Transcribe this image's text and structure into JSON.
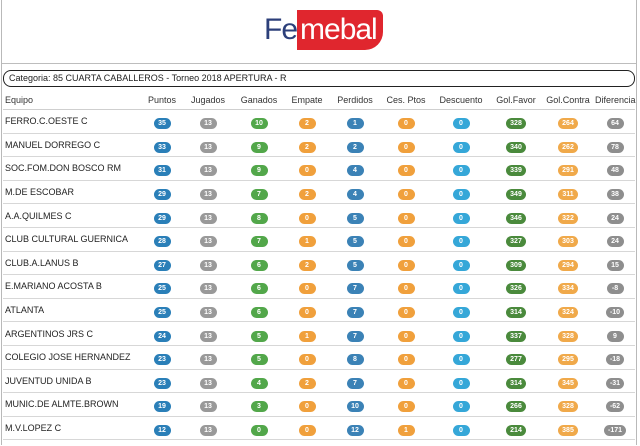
{
  "brand": {
    "logo_left": "Fe",
    "logo_right": "mebal"
  },
  "category": "Categoria: 85 CUARTA CABALLEROS - Torneo 2018 APERTURA - R",
  "columns": [
    "Equipo",
    "Puntos",
    "Jugados",
    "Ganados",
    "Empate",
    "Perdidos",
    "Ces. Ptos",
    "Descuento",
    "Gol.Favor",
    "Gol.Contra",
    "Diferencia"
  ],
  "colors": {
    "puntos": "#2a7fb8",
    "jugados": "#999999",
    "ganados": "#52a74a",
    "empate": "#f0a03c",
    "perdidos": "#3b82b6",
    "ces_ptos": "#f0a03c",
    "descuento": "#35a7d8",
    "gol_favor": "#4a8a3c",
    "gol_contra": "#f0a94a",
    "diferencia": "#8e8e8e"
  },
  "rows": [
    {
      "team": "FERRO.C.OESTE C",
      "values": [
        "35",
        "13",
        "10",
        "2",
        "1",
        "0",
        "0",
        "328",
        "264",
        "64"
      ]
    },
    {
      "team": "MANUEL DORREGO C",
      "values": [
        "33",
        "13",
        "9",
        "2",
        "2",
        "0",
        "0",
        "340",
        "262",
        "78"
      ]
    },
    {
      "team": "SOC.FOM.DON BOSCO RM",
      "values": [
        "31",
        "13",
        "9",
        "0",
        "4",
        "0",
        "0",
        "339",
        "291",
        "48"
      ]
    },
    {
      "team": "M.DE ESCOBAR",
      "values": [
        "29",
        "13",
        "7",
        "2",
        "4",
        "0",
        "0",
        "349",
        "311",
        "38"
      ]
    },
    {
      "team": "A.A.QUILMES C",
      "values": [
        "29",
        "13",
        "8",
        "0",
        "5",
        "0",
        "0",
        "346",
        "322",
        "24"
      ]
    },
    {
      "team": "CLUB CULTURAL GUERNICA",
      "values": [
        "28",
        "13",
        "7",
        "1",
        "5",
        "0",
        "0",
        "327",
        "303",
        "24"
      ]
    },
    {
      "team": "CLUB.A.LANUS B",
      "values": [
        "27",
        "13",
        "6",
        "2",
        "5",
        "0",
        "0",
        "309",
        "294",
        "15"
      ]
    },
    {
      "team": "E.MARIANO ACOSTA B",
      "values": [
        "25",
        "13",
        "6",
        "0",
        "7",
        "0",
        "0",
        "326",
        "334",
        "-8"
      ]
    },
    {
      "team": "ATLANTA",
      "values": [
        "25",
        "13",
        "6",
        "0",
        "7",
        "0",
        "0",
        "314",
        "324",
        "-10"
      ]
    },
    {
      "team": "ARGENTINOS JRS C",
      "values": [
        "24",
        "13",
        "5",
        "1",
        "7",
        "0",
        "0",
        "337",
        "328",
        "9"
      ]
    },
    {
      "team": "COLEGIO JOSE HERNANDEZ",
      "values": [
        "23",
        "13",
        "5",
        "0",
        "8",
        "0",
        "0",
        "277",
        "295",
        "-18"
      ]
    },
    {
      "team": "JUVENTUD UNIDA B",
      "values": [
        "23",
        "13",
        "4",
        "2",
        "7",
        "0",
        "0",
        "314",
        "345",
        "-31"
      ]
    },
    {
      "team": "MUNIC.DE ALMTE.BROWN",
      "values": [
        "19",
        "13",
        "3",
        "0",
        "10",
        "0",
        "0",
        "266",
        "328",
        "-62"
      ]
    },
    {
      "team": "M.V.LOPEZ C",
      "values": [
        "12",
        "13",
        "0",
        "0",
        "12",
        "1",
        "0",
        "214",
        "385",
        "-171"
      ]
    }
  ]
}
